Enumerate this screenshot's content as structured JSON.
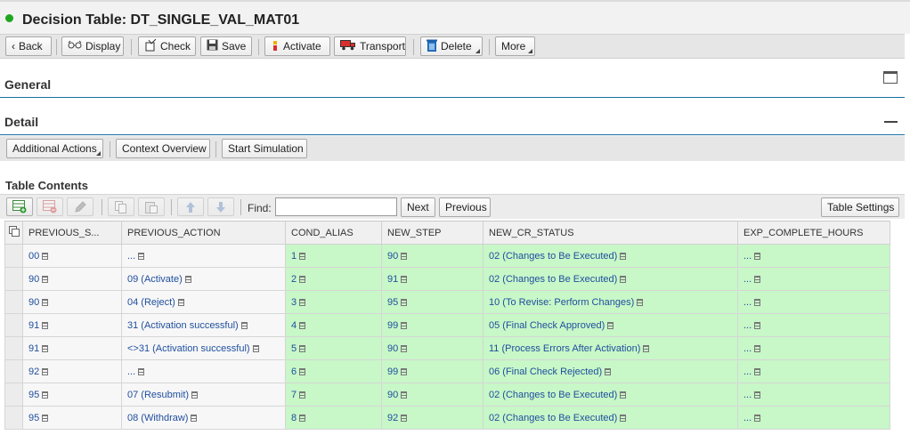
{
  "title": "Decision Table: DT_SINGLE_VAL_MAT01",
  "toolbar": {
    "back": "Back",
    "display": "Display",
    "check": "Check",
    "save": "Save",
    "activate": "Activate",
    "transport": "Transport",
    "delete": "Delete",
    "more": "More"
  },
  "sections": {
    "general": "General",
    "detail": "Detail"
  },
  "detail_toolbar": {
    "additional_actions": "Additional Actions",
    "context_overview": "Context Overview",
    "start_simulation": "Start Simulation"
  },
  "table_contents": {
    "title": "Table Contents",
    "find_label": "Find:",
    "find_value": "",
    "next": "Next",
    "previous": "Previous",
    "table_settings": "Table Settings"
  },
  "columns": [
    "PREVIOUS_S...",
    "PREVIOUS_ACTION",
    "COND_ALIAS",
    "NEW_STEP",
    "NEW_CR_STATUS",
    "EXP_COMPLETE_HOURS"
  ],
  "rows": [
    [
      "00",
      "...",
      "1",
      "90",
      "02 (Changes to Be Executed)",
      "..."
    ],
    [
      "90",
      "09 (Activate)",
      "2",
      "91",
      "02 (Changes to Be Executed)",
      "..."
    ],
    [
      "90",
      "04 (Reject)",
      "3",
      "95",
      "10 (To Revise: Perform Changes)",
      "..."
    ],
    [
      "91",
      "31 (Activation successful)",
      "4",
      "99",
      "05 (Final Check Approved)",
      "..."
    ],
    [
      "91",
      "<>31 (Activation successful)",
      "5",
      "90",
      "11 (Process Errors After Activation)",
      "..."
    ],
    [
      "92",
      "...",
      "6",
      "99",
      "06 (Final Check Rejected)",
      "..."
    ],
    [
      "95",
      "07 (Resubmit)",
      "7",
      "90",
      "02 (Changes to Be Executed)",
      "..."
    ],
    [
      "95",
      "08 (Withdraw)",
      "8",
      "92",
      "02 (Changes to Be Executed)",
      "..."
    ]
  ],
  "colors": {
    "condition_cell": "#f7f7f7",
    "result_cell": "#c8f7c8",
    "section_rule": "#1a6e9e",
    "status_green": "#1fa61f"
  }
}
